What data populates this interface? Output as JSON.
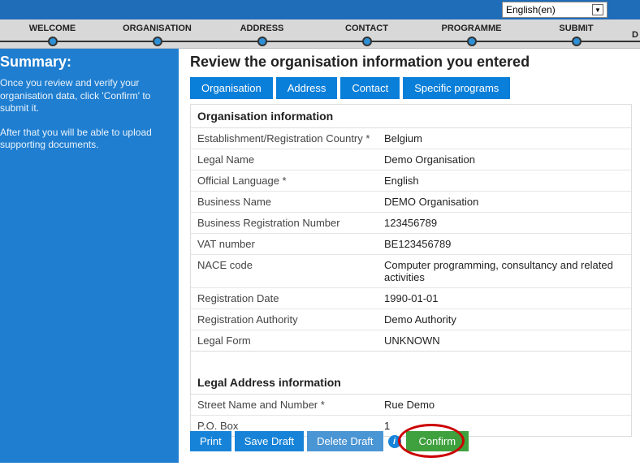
{
  "language": {
    "selected": "English(en)"
  },
  "steps": [
    "WELCOME",
    "ORGANISATION",
    "ADDRESS",
    "CONTACT",
    "PROGRAMME",
    "SUBMIT",
    "D"
  ],
  "sidebar": {
    "title": "Summary:",
    "para1": "Once you review and verify your organisation data, click 'Confirm' to submit it.",
    "para2": "After that you will be able to upload supporting documents."
  },
  "main": {
    "heading": "Review the organisation information you entered",
    "tabs": [
      "Organisation",
      "Address",
      "Contact",
      "Specific programs"
    ]
  },
  "orgSection": {
    "heading": "Organisation information",
    "rows": [
      {
        "label": "Establishment/Registration Country *",
        "value": "Belgium"
      },
      {
        "label": "Legal Name",
        "value": "Demo Organisation"
      },
      {
        "label": "Official Language *",
        "value": "English"
      },
      {
        "label": "Business Name",
        "value": "DEMO Organisation"
      },
      {
        "label": "Business Registration Number",
        "value": "123456789"
      },
      {
        "label": "VAT number",
        "value": "BE123456789"
      },
      {
        "label": "NACE code",
        "value": "Computer programming, consultancy and related activities"
      },
      {
        "label": "Registration Date",
        "value": "1990-01-01"
      },
      {
        "label": "Registration Authority",
        "value": "Demo Authority"
      },
      {
        "label": "Legal Form",
        "value": "UNKNOWN"
      }
    ]
  },
  "addrSection": {
    "heading": "Legal Address information",
    "rows": [
      {
        "label": "Street Name and Number *",
        "value": "Rue Demo"
      },
      {
        "label": "P.O. Box",
        "value": "1"
      }
    ]
  },
  "actions": {
    "print": "Print",
    "saveDraft": "Save Draft",
    "deleteDraft": "Delete Draft",
    "confirm": "Confirm"
  }
}
